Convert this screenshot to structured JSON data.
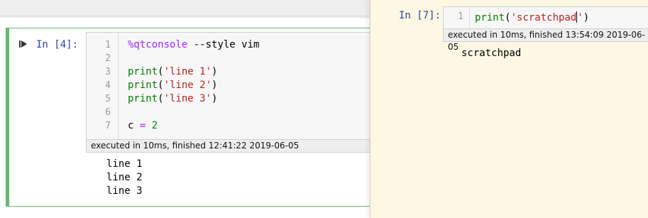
{
  "main_cell": {
    "prompt": "In [4]:",
    "line_numbers": [
      "1",
      "2",
      "3",
      "4",
      "5",
      "6",
      "7"
    ],
    "code": {
      "l1_magic": "%qtconsole",
      "l1_rest": " --style vim",
      "l3_fn": "print",
      "l3_open": "(",
      "l3_str": "'line 1'",
      "l3_close": ")",
      "l4_fn": "print",
      "l4_open": "(",
      "l4_str": "'line 2'",
      "l4_close": ")",
      "l5_fn": "print",
      "l5_open": "(",
      "l5_str": "'line 3'",
      "l5_close": ")",
      "l7_var": "c ",
      "l7_op": "=",
      "l7_num": " 2"
    },
    "exec_info": "executed in 10ms, finished 12:41:22 2019-06-05",
    "outputs": [
      "line 1",
      "line 2",
      "line 3"
    ]
  },
  "scratchpad": {
    "prompt": "In [7]:",
    "line_number": "1",
    "code_fn": "print",
    "code_open": "(",
    "code_str_before_cursor": "'scratchpad",
    "code_str_after_cursor": "'",
    "code_close": ")",
    "exec_info": "executed in 10ms, finished 13:54:09 2019-06-05",
    "output": "scratchpad"
  },
  "colors": {
    "cell_border": "#66bb6a",
    "prompt": "#303f9f",
    "string": "#ba2121",
    "builtin": "#008000",
    "magic": "#aa22ff",
    "scratchpad_bg": "#fcf8e3"
  },
  "icons": {
    "run": "step-forward-icon"
  }
}
